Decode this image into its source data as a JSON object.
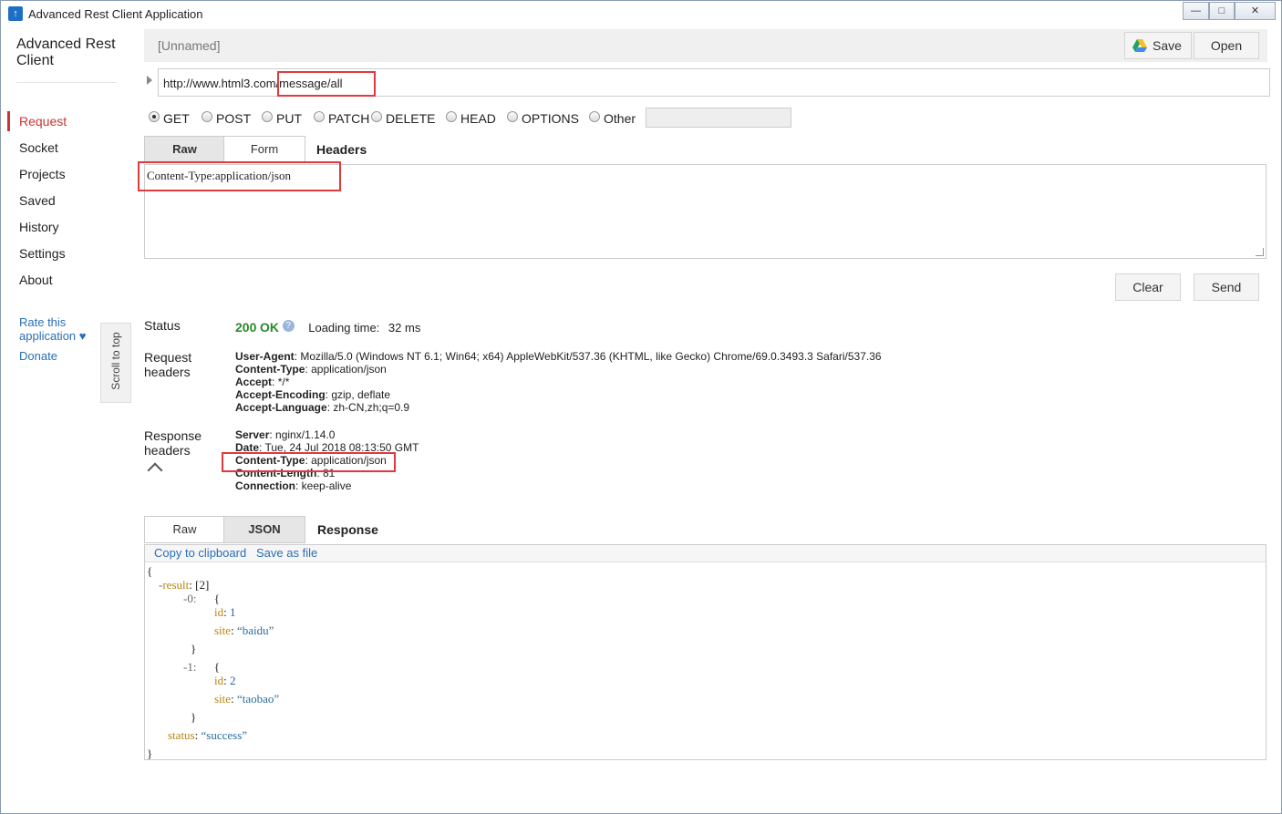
{
  "window": {
    "title": "Advanced Rest Client Application",
    "controls": [
      "—",
      "□",
      "✕"
    ]
  },
  "sidebar": {
    "logo_line1": "Advanced Rest",
    "logo_line2": "Client",
    "items": [
      {
        "label": "Request",
        "active": true
      },
      {
        "label": "Socket"
      },
      {
        "label": "Projects"
      },
      {
        "label": "Saved"
      },
      {
        "label": "History"
      },
      {
        "label": "Settings"
      },
      {
        "label": "About"
      }
    ],
    "rate_line1": "Rate this",
    "rate_line2": "application ♥",
    "donate": "Donate",
    "scroll_top": "Scroll to top"
  },
  "request": {
    "name": "[Unnamed]",
    "save_label": "Save",
    "open_label": "Open",
    "url_base": "http://www.html3.com/",
    "url_path": "message/all",
    "methods": [
      "GET",
      "POST",
      "PUT",
      "PATCH",
      "DELETE",
      "HEAD",
      "OPTIONS",
      "Other"
    ],
    "selected_method": "GET",
    "headers_tabs": {
      "raw": "Raw",
      "form": "Form",
      "title": "Headers"
    },
    "headers_text": "Content-Type:application/json",
    "clear_label": "Clear",
    "send_label": "Send"
  },
  "response": {
    "status_label": "Status",
    "status_code": "200",
    "status_text": "OK",
    "help_glyph": "?",
    "loading_time_label": "Loading time:",
    "loading_time_value": "32 ms",
    "request_headers_label_1": "Request",
    "request_headers_label_2": "headers",
    "request_headers": [
      {
        "name": "User-Agent",
        "value": "Mozilla/5.0 (Windows NT 6.1; Win64; x64) AppleWebKit/537.36 (KHTML, like Gecko) Chrome/69.0.3493.3 Safari/537.36"
      },
      {
        "name": "Content-Type",
        "value": "application/json"
      },
      {
        "name": "Accept",
        "value": "*/*"
      },
      {
        "name": "Accept-Encoding",
        "value": "gzip, deflate"
      },
      {
        "name": "Accept-Language",
        "value": "zh-CN,zh;q=0.9"
      }
    ],
    "response_headers_label_1": "Response",
    "response_headers_label_2": "headers",
    "response_headers": [
      {
        "name": "Server",
        "value": "nginx/1.14.0"
      },
      {
        "name": "Date",
        "value": "Tue, 24 Jul 2018 08:13:50 GMT"
      },
      {
        "name": "Content-Type",
        "value": "application/json"
      },
      {
        "name": "Content-Length",
        "value": "81"
      },
      {
        "name": "Connection",
        "value": "keep-alive"
      }
    ],
    "tabs": {
      "raw": "Raw",
      "json": "JSON",
      "title": "Response"
    },
    "copy_label": "Copy to clipboard",
    "save_file_label": "Save as file",
    "json": {
      "open_brace": "{",
      "result_toggle": "-",
      "result_key": "result",
      "colon": ":",
      "result_count": "[2]",
      "item0_toggle": "-0:",
      "item1_toggle": "-1:",
      "item_open": "{",
      "item_close": "}",
      "id_key": "id",
      "site_key": "site",
      "item0_id": "1",
      "item0_site": "“baidu”",
      "item1_id": "2",
      "item1_site": "“taobao”",
      "status_key": "status",
      "status_value": "“success”",
      "close_brace": "}"
    }
  },
  "colors": {
    "accent_red": "#e0393e",
    "active_nav": "#c33",
    "link": "#2a6eb8",
    "ok_green": "#2a8a2a"
  }
}
